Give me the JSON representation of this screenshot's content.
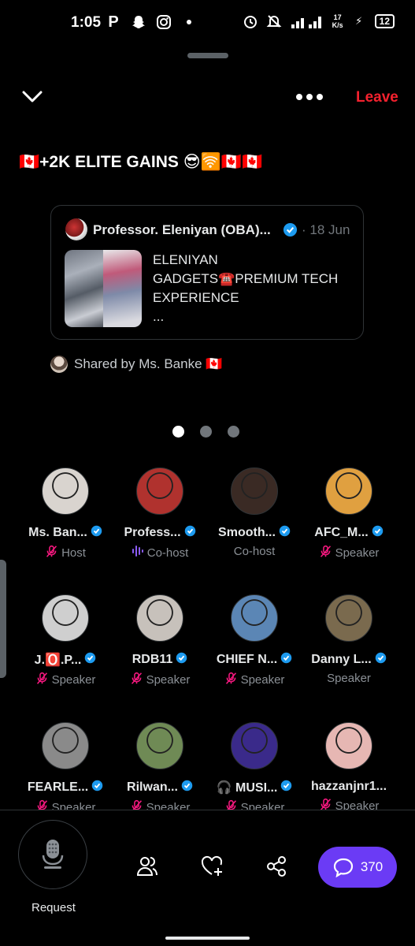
{
  "status_bar": {
    "time": "1:05",
    "left_icons": [
      "parking-icon",
      "snapchat-icon",
      "instagram-icon",
      "dot-icon"
    ],
    "net_speed_value": "17",
    "net_speed_unit": "K/s",
    "network": "4G",
    "battery": "12"
  },
  "header": {
    "leave_label": "Leave",
    "title": "🇨🇦+2K ELITE GAINS 😎🛜🇨🇦🇨🇦"
  },
  "tweet_card": {
    "author": "Professor. Eleniyan (OBA)...",
    "date": "· 18 Jun",
    "body_line1": "ELENIYAN",
    "body_line2": "GADGETS☎️PREMIUM TECH",
    "body_line3": "EXPERIENCE",
    "body_line4": "..."
  },
  "shared_by": "Shared by Ms. Banke 🇨🇦",
  "pager": {
    "count": 3,
    "active": 0
  },
  "participants": [
    {
      "name": "Ms. Ban...",
      "role": "Host",
      "muted": true,
      "speaking": false,
      "verified": true,
      "color": "#d9d4cf"
    },
    {
      "name": "Profess...",
      "role": "Co-host",
      "muted": false,
      "speaking": true,
      "verified": true,
      "color": "#b0322e"
    },
    {
      "name": "Smooth...",
      "role": "Co-host",
      "muted": false,
      "speaking": false,
      "verified": true,
      "color": "#3a2a24"
    },
    {
      "name": "AFC_M...",
      "role": "Speaker",
      "muted": true,
      "speaking": false,
      "verified": true,
      "color": "#e0a040"
    },
    {
      "name": "J.🅾️.P...",
      "role": "Speaker",
      "muted": true,
      "speaking": false,
      "verified": true,
      "color": "#cfcfcf"
    },
    {
      "name": "RDB11",
      "role": "Speaker",
      "muted": true,
      "speaking": false,
      "verified": true,
      "color": "#c7c1bb"
    },
    {
      "name": "CHIEF N...",
      "role": "Speaker",
      "muted": true,
      "speaking": false,
      "verified": true,
      "color": "#5b86b5"
    },
    {
      "name": "Danny L...",
      "role": "Speaker",
      "muted": false,
      "speaking": false,
      "verified": true,
      "color": "#7a6a4e"
    },
    {
      "name": "FEARLE...",
      "role": "Speaker",
      "muted": true,
      "speaking": false,
      "verified": true,
      "color": "#8a8a8a"
    },
    {
      "name": "Rilwan...",
      "role": "Speaker",
      "muted": true,
      "speaking": false,
      "verified": true,
      "color": "#6f8a55"
    },
    {
      "name": "🎧 MUSI...",
      "role": "Speaker",
      "muted": true,
      "speaking": false,
      "verified": true,
      "color": "#3a2a8a"
    },
    {
      "name": "hazzanjnr1...",
      "role": "Speaker",
      "muted": true,
      "speaking": false,
      "verified": false,
      "color": "#e6b7b3"
    }
  ],
  "bottom_bar": {
    "request_label": "Request",
    "chat_count": "370"
  },
  "colors": {
    "accent_red": "#f4212e",
    "verified_blue": "#1d9bf0",
    "muted_pink": "#f91880",
    "chat_purple": "#6b3bf5"
  }
}
